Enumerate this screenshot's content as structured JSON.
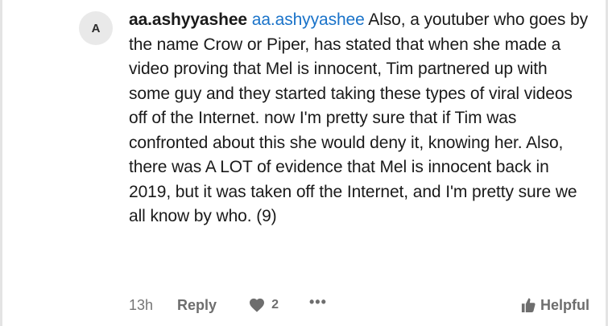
{
  "comment": {
    "avatar_initial": "A",
    "username": "aa.ashyyashee",
    "mention": "aa.ashyyashee",
    "text": "Also, a youtuber who goes by the name Crow or Piper, has stated that when she made a video proving that Mel is innocent, Tim partnered up with some guy and they started taking these types of viral videos off of the Internet. now I'm pretty sure that if Tim was confronted about this she would deny it, knowing her. Also, there was A LOT of evidence that Mel is innocent back in 2019, but it was taken off the Internet, and I'm pretty sure we all know by who. (9)",
    "timestamp": "13h",
    "reply_label": "Reply",
    "like_count": "2",
    "more_label": "•••",
    "helpful_label": "Helpful"
  },
  "icons": {
    "like": "heart-icon",
    "more": "more-options-icon",
    "helpful": "thumbs-up-icon"
  },
  "colors": {
    "mention": "#1a73c9",
    "avatar_bg": "#e9e9e9",
    "muted": "#767676"
  }
}
